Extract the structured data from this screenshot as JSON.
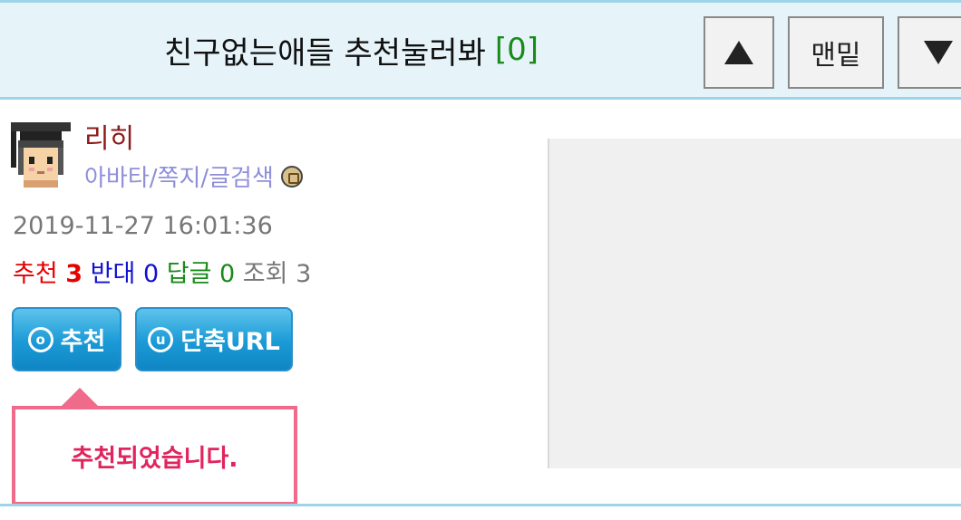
{
  "header": {
    "title": "친구없는애들 추천눌러봐",
    "comment_count": "[0]",
    "btn_up_icon": "triangle-up-icon",
    "btn_bottom_label": "맨밑",
    "btn_down_icon": "triangle-down-icon"
  },
  "author": {
    "nickname": "리히",
    "links": "아바타/쪽지/글검색",
    "medal_icon": "medal-icon"
  },
  "post": {
    "date": "2019-11-27 16:01:36",
    "stats": {
      "recommend_label": "추천",
      "recommend_value": "3",
      "oppose_label": "반대",
      "oppose_value": "0",
      "reply_label": "답글",
      "reply_value": "0",
      "views_label": "조회",
      "views_value": "3"
    }
  },
  "actions": {
    "recommend_icon_letter": "o",
    "recommend_label": "추천",
    "shorturl_icon_letter": "u",
    "shorturl_label": "단축URL"
  },
  "tooltip": {
    "message": "추천되었습니다."
  },
  "colors": {
    "header_bg": "#e6f4fa",
    "accent_blue": "#1a9ad6",
    "tooltip_pink": "#f06a8a",
    "recommend_red": "#e60000"
  }
}
